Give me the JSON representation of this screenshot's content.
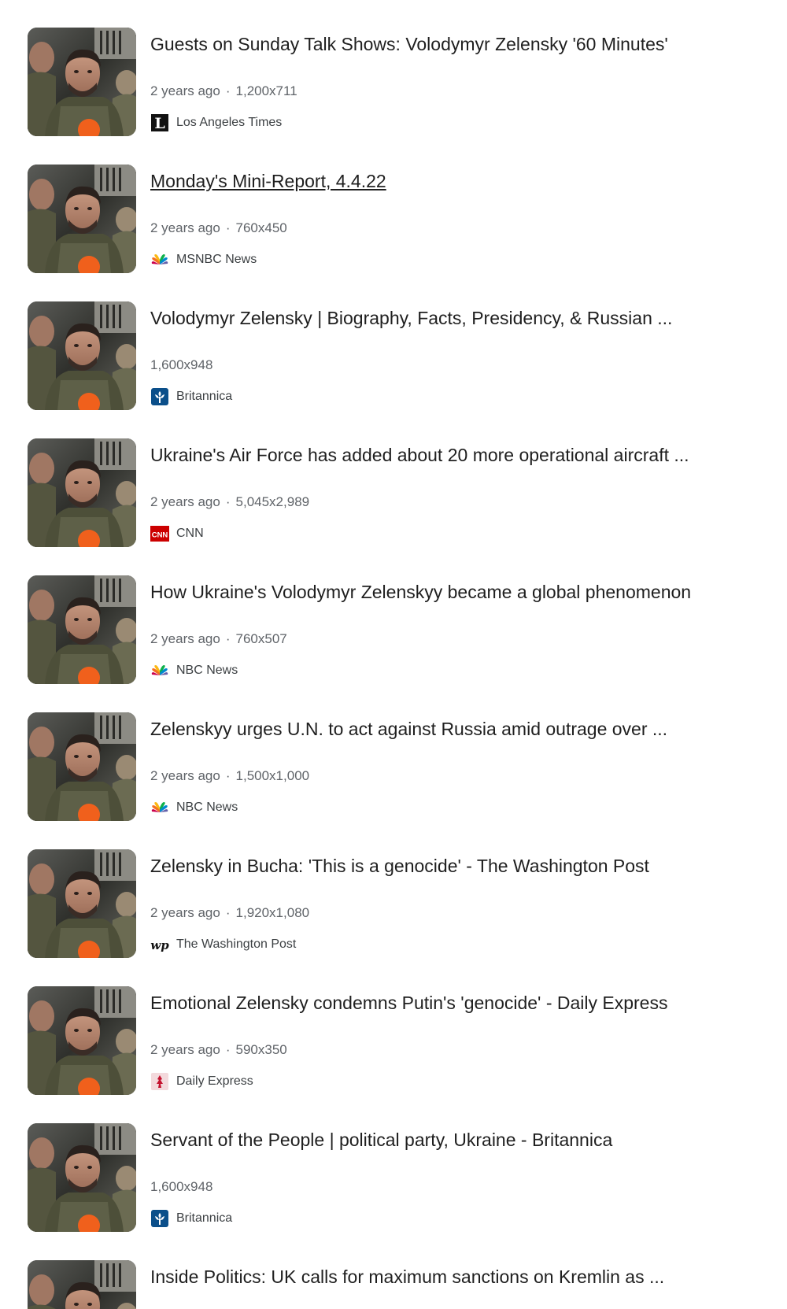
{
  "results": [
    {
      "title": "Guests on Sunday Talk Shows: Volodymyr Zelensky '60 Minutes'",
      "age": "2 years ago",
      "dimensions": "1,200x711",
      "source": "Los Angeles Times",
      "favicon": "la-times-icon"
    },
    {
      "title": "Monday's Mini-Report, 4.4.22",
      "age": "2 years ago",
      "dimensions": "760x450",
      "source": "MSNBC News",
      "favicon": "msnbc-peacock-icon"
    },
    {
      "title": "Volodymyr Zelensky | Biography, Facts, Presidency, & Russian ...",
      "age": "",
      "dimensions": "1,600x948",
      "source": "Britannica",
      "favicon": "britannica-icon"
    },
    {
      "title": "Ukraine's Air Force has added about 20 more operational aircraft ...",
      "age": "2 years ago",
      "dimensions": "5,045x2,989",
      "source": "CNN",
      "favicon": "cnn-icon"
    },
    {
      "title": "How Ukraine's Volodymyr Zelenskyy became a global phenomenon",
      "age": "2 years ago",
      "dimensions": "760x507",
      "source": "NBC News",
      "favicon": "nbc-peacock-icon"
    },
    {
      "title": "Zelenskyy urges U.N. to act against Russia amid outrage over ...",
      "age": "2 years ago",
      "dimensions": "1,500x1,000",
      "source": "NBC News",
      "favicon": "nbc-peacock-icon"
    },
    {
      "title": "Zelensky in Bucha: 'This is a genocide' - The Washington Post",
      "age": "2 years ago",
      "dimensions": "1,920x1,080",
      "source": "The Washington Post",
      "favicon": "washington-post-icon"
    },
    {
      "title": "Emotional Zelensky condemns Putin's 'genocide' - Daily Express",
      "age": "2 years ago",
      "dimensions": "590x350",
      "source": "Daily Express",
      "favicon": "daily-express-icon"
    },
    {
      "title": "Servant of the People | political party, Ukraine - Britannica",
      "age": "",
      "dimensions": "1,600x948",
      "source": "Britannica",
      "favicon": "britannica-icon"
    },
    {
      "title": "Inside Politics: UK calls for maximum sanctions on Kremlin as ...",
      "age": "",
      "dimensions": "",
      "source": "",
      "favicon": ""
    }
  ],
  "colors": {
    "title": "#1f1f1f",
    "meta": "#5f6368",
    "cnn_red": "#cc0000",
    "britannica_blue": "#0b4f8a"
  }
}
